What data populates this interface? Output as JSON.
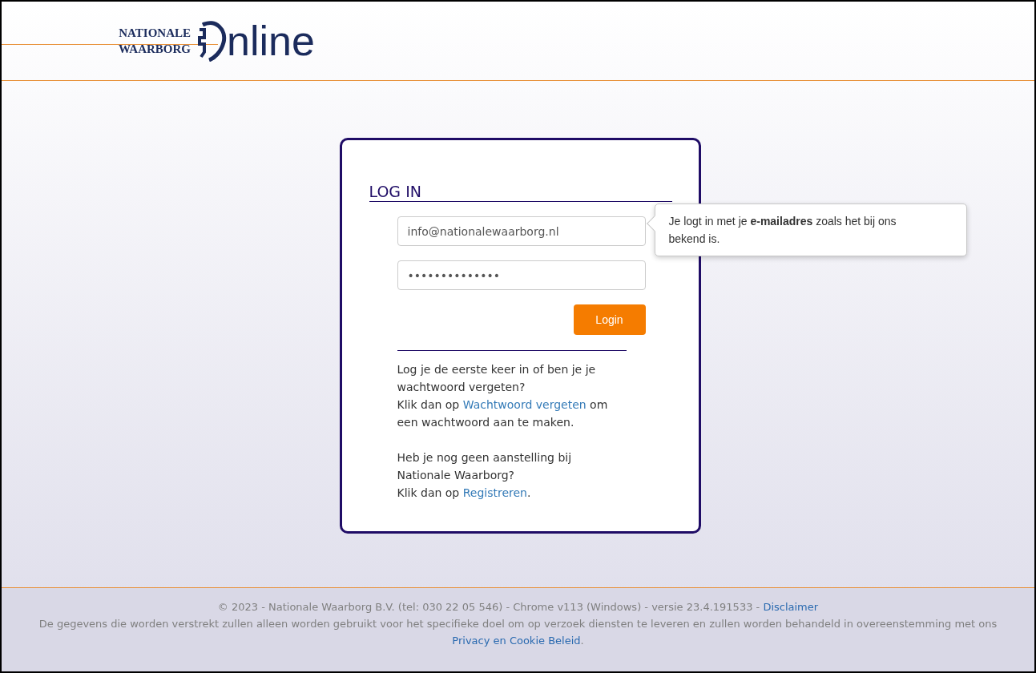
{
  "logo": {
    "line_1": "NATIONALE",
    "line_2": "WAARBORG",
    "word": "nline"
  },
  "login": {
    "title": "LOG IN",
    "email": {
      "value": "info@nationalewaarborg.nl"
    },
    "password": {
      "value": "••••••••••••••"
    },
    "button": "Login",
    "help": [
      [
        {
          "text": "Log je de eerste keer in of ben je je wachtwoord vergeten?"
        },
        {
          "before": "Klik dan op",
          "link": "Wachtwoord vergeten",
          "after": "om een wachtwoord aan te maken."
        }
      ],
      [
        {
          "text": "Heb je nog geen aanstelling bij Nationale Waarborg?"
        },
        {
          "before": "Klik dan op",
          "link": "Registreren",
          "after": "."
        }
      ]
    ]
  },
  "tooltip": {
    "text": "Je logt in met je **e-mailadres** zoals het bij ons bekend is."
  },
  "footer": {
    "line_1": "© 2023 - Nationale Waarborg B.V. (tel: 030 22 05 546) - Chrome v113 (Windows) - versie 23.4.191533 -",
    "line_1_link": "Disclaimer",
    "line_2": "De gegevens die worden verstrekt zullen alleen worden gebruikt voor het specifieke doel om op verzoek diensten te leveren en zullen worden behandeld in overeenstemming met ons",
    "line_2_link": "Privacy en Cookie Beleid",
    "line_2_end": "."
  }
}
